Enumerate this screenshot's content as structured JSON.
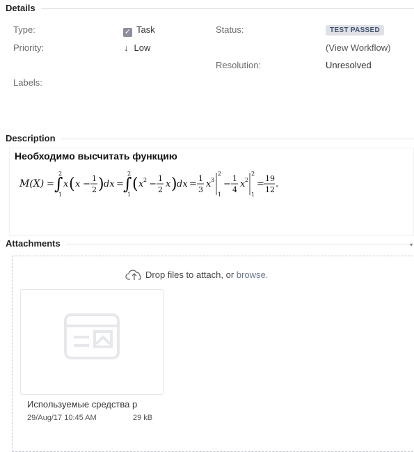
{
  "details": {
    "section_title": "Details",
    "type_label": "Type:",
    "type_value": "Task",
    "priority_label": "Priority:",
    "priority_value": "Low",
    "status_label": "Status:",
    "status_value": "TEST PASSED",
    "view_workflow": "(View Workflow)",
    "resolution_label": "Resolution:",
    "resolution_value": "Unresolved",
    "labels_label": "Labels:"
  },
  "description": {
    "section_title": "Description",
    "heading": "Необходимо высчитать функцию"
  },
  "attachments": {
    "section_title": "Attachments",
    "drop_prefix": "Drop files to attach, or ",
    "browse": "browse.",
    "file": {
      "name": "Используемые средства р",
      "date": "29/Aug/17 10:45 AM",
      "size": "29 kB"
    }
  },
  "colors": {
    "badge_bg": "#dfe1e6",
    "link": "#6b778c"
  }
}
